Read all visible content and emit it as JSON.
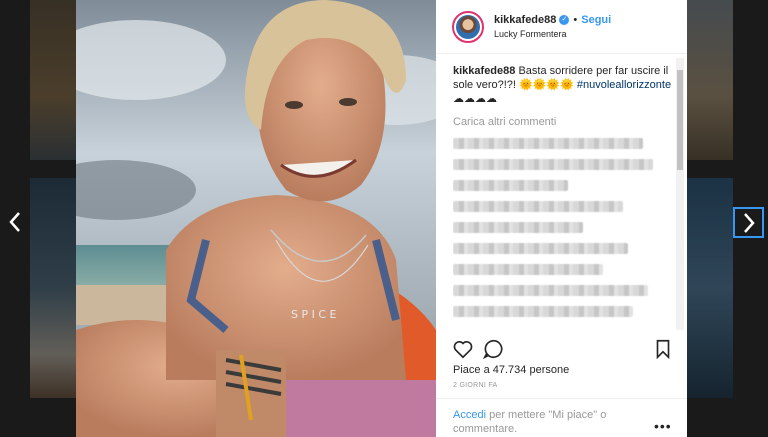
{
  "post": {
    "username": "kikkafede88",
    "follow_label": "Segui",
    "separator": "•",
    "location": "Lucky Formentera",
    "caption_username": "kikkafede88",
    "caption_text": "Basta sorridere per far uscire il sole vero?!?! 🌞🌞🌞🌞",
    "hashtag": "#nuvoleallorizzonte",
    "hashtag_suffix": "☁☁☁☁",
    "load_more": "Carica altri commenti",
    "likes_prefix": "Piace a ",
    "likes_count": "47.734",
    "likes_suffix": " persone",
    "time": "2 GIORNI FA",
    "login_link": "Accedi",
    "login_text": " per mettere \"Mi piace\" o commentare.",
    "more_label": "•••"
  },
  "icons": {
    "prev": "chevron-left-icon",
    "next": "chevron-right-icon",
    "like": "heart-icon",
    "comment": "comment-icon",
    "save": "bookmark-icon",
    "verified": "verified-badge-icon"
  },
  "colors": {
    "accent": "#3897f0",
    "text": "#262626",
    "muted": "#999999"
  }
}
